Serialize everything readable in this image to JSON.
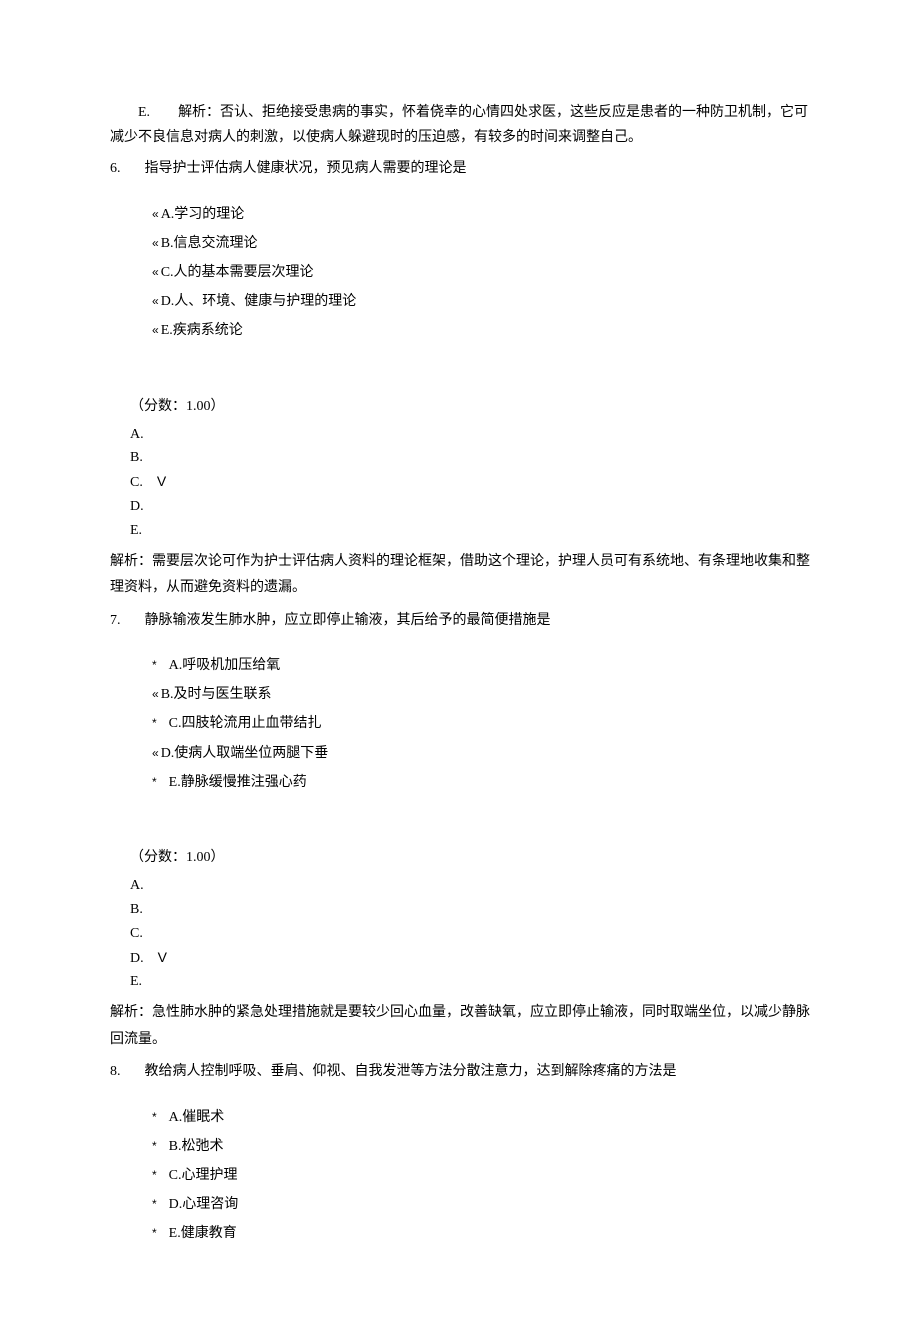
{
  "q5": {
    "explain_prefix": "E.",
    "explain_text": "解析：否认、拒绝接受患病的事实，怀着侥幸的心情四处求医，这些反应是患者的一种防卫机制，它可减少不良信息对病人的刺激，以使病人躲避现时的压迫感，有较多的时间来调整自己。"
  },
  "q6": {
    "number": "6.",
    "stem": "指导护士评估病人健康状况，预见病人需要的理论是",
    "options": {
      "A": "A.学习的理论",
      "B": "B.信息交流理论",
      "C": "C.人的基本需要层次理论",
      "D": "D.人、环境、健康与护理的理论",
      "E": "E.疾病系统论"
    },
    "score": "（分数：1.00）",
    "answers": {
      "A": "A.",
      "B": "B.",
      "C": "C.",
      "C_mark": "V",
      "D": "D.",
      "E": "E."
    },
    "explanation": "解析：需要层次论可作为护士评估病人资料的理论框架，借助这个理论，护理人员可有系统地、有条理地收集和整理资料，从而避免资料的遗漏。"
  },
  "q7": {
    "number": "7.",
    "stem": "静脉输液发生肺水肿，应立即停止输液，其后给予的最简便措施是",
    "options": {
      "A": "A.呼吸机加压给氧",
      "B": "B.及时与医生联系",
      "C": "C.四肢轮流用止血带结扎",
      "D": "D.使病人取端坐位两腿下垂",
      "E": "E.静脉缓慢推注强心药"
    },
    "score": "（分数：1.00）",
    "answers": {
      "A": "A.",
      "B": "B.",
      "C": "C.",
      "D": "D.",
      "D_mark": "V",
      "E": "E."
    },
    "explanation": "解析：急性肺水肿的紧急处理措施就是要较少回心血量，改善缺氧，应立即停止输液，同时取端坐位，以减少静脉回流量。"
  },
  "q8": {
    "number": "8.",
    "stem": "教给病人控制呼吸、垂肩、仰视、自我发泄等方法分散注意力，达到解除疼痛的方法是",
    "options": {
      "A": "A.催眠术",
      "B": "B.松弛术",
      "C": "C.心理护理",
      "D": "D.心理咨询",
      "E": "E.健康教育"
    }
  },
  "bullets": {
    "quote": "«",
    "star": "*"
  }
}
